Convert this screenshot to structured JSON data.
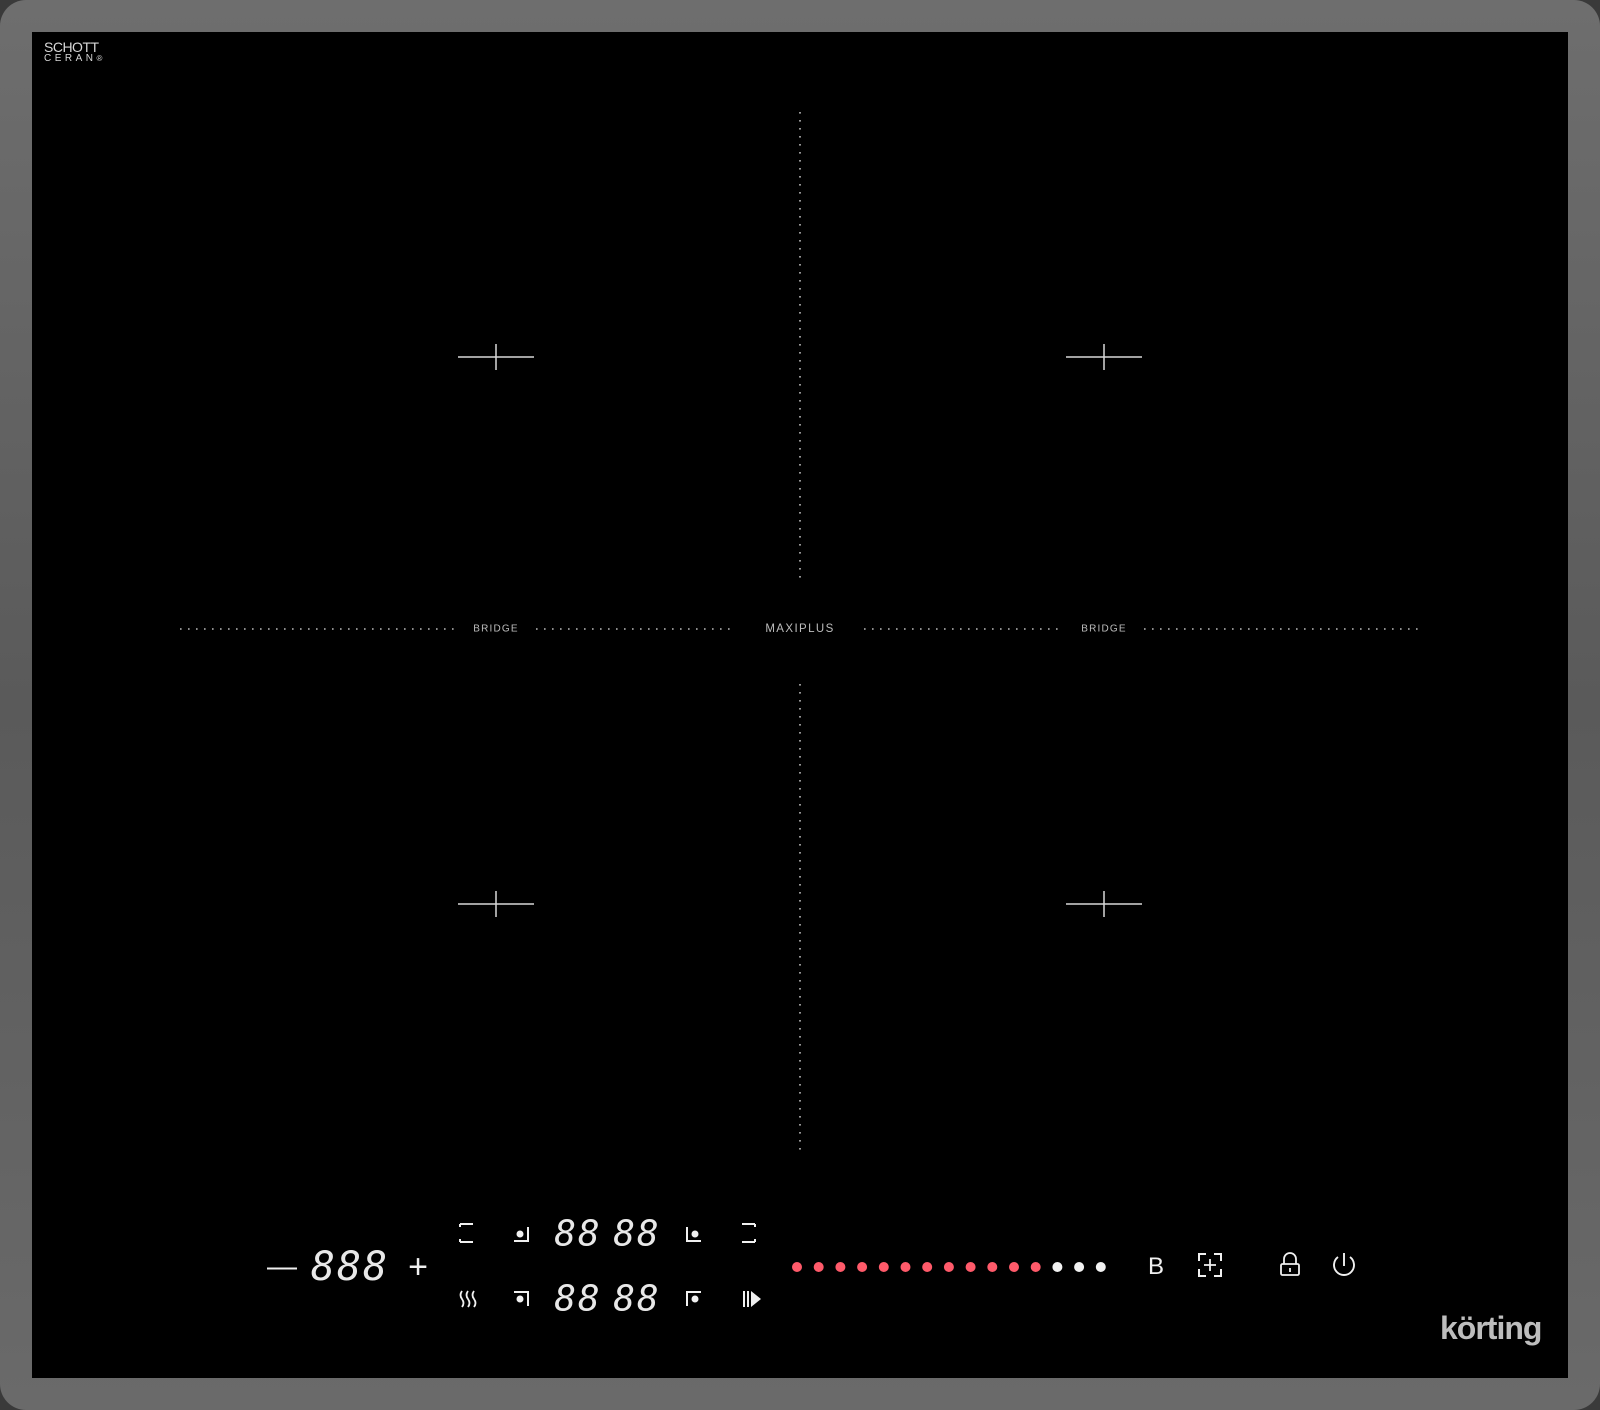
{
  "logo": {
    "line1": "SCHOTT",
    "line2": "CERAN",
    "registered": "®"
  },
  "brand": "körting",
  "zone_labels": {
    "left": "BRIDGE",
    "center": "MAXIPLUS",
    "right": "BRIDGE"
  },
  "displays": {
    "timer": "888",
    "top_left": "88",
    "top_right": "88",
    "bottom_left": "88",
    "bottom_right": "88"
  },
  "controls": {
    "minus": "—",
    "plus": "+",
    "bridge_button": "B"
  },
  "power_slider": {
    "total_levels": 15,
    "active_levels": 12,
    "active_color": "#ff5a6a",
    "inactive_color": "#f2f2f2"
  },
  "icons": [
    "zone-top-left-icon",
    "zone-top-right-icon",
    "zone-bottom-left-icon",
    "zone-bottom-right-icon",
    "keep-warm-icon",
    "pause-play-icon",
    "boost-icon",
    "lock-icon",
    "power-icon"
  ]
}
